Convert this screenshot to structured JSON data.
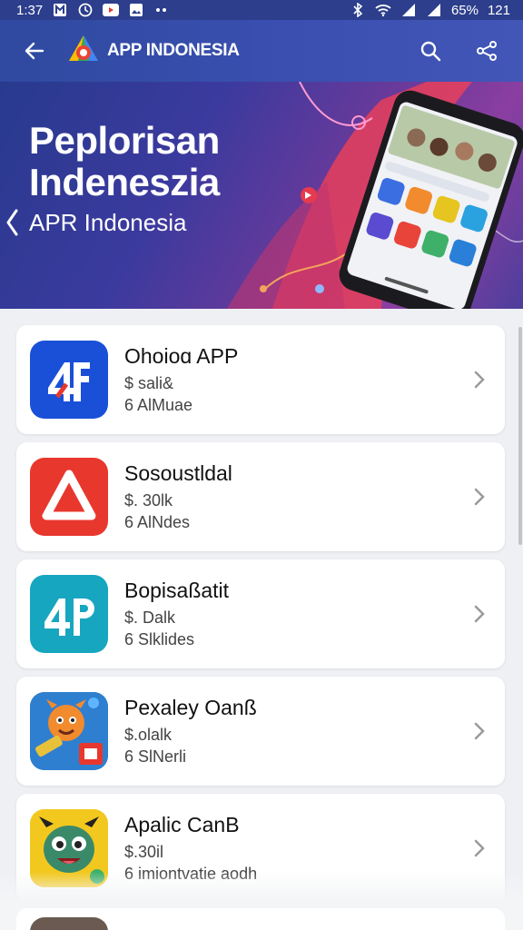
{
  "status_bar": {
    "time": "1:37",
    "battery": "65%",
    "extra": "121"
  },
  "app_bar": {
    "title": "APP INDONESIA"
  },
  "hero": {
    "title_line1": "Peplorisan",
    "title_line2": "Indeneszia",
    "subtitle": "APR Indonesia"
  },
  "apps": [
    {
      "name": "Ohoioɑ APP",
      "price": "$ sali&",
      "meta": "6 AlMuae",
      "icon": "ap-logo-blue-icon",
      "color": "#1a4fd8"
    },
    {
      "name": "Sosoustldal",
      "price": "$. 30lk",
      "meta": "6 AlNdes",
      "icon": "triangle-logo-red-icon",
      "color": "#e8372d"
    },
    {
      "name": "Bopisaßatit",
      "price": "$. Dalk",
      "meta": "6 Slklides",
      "icon": "ap-logo-teal-icon",
      "color": "#17a6c0"
    },
    {
      "name": "Pexaley Oanß",
      "price": "$.olalk",
      "meta": "6 SlNerli",
      "icon": "game-monster-icon",
      "color": "#2f7fd0"
    },
    {
      "name": "Apalic CanB",
      "price": "$.30il",
      "meta": "6 imiontvatie aodh",
      "icon": "game-character-icon",
      "color": "#f2c81f"
    }
  ],
  "colors": {
    "app_bar": "#3a4fb0",
    "background": "#eef0f4"
  }
}
